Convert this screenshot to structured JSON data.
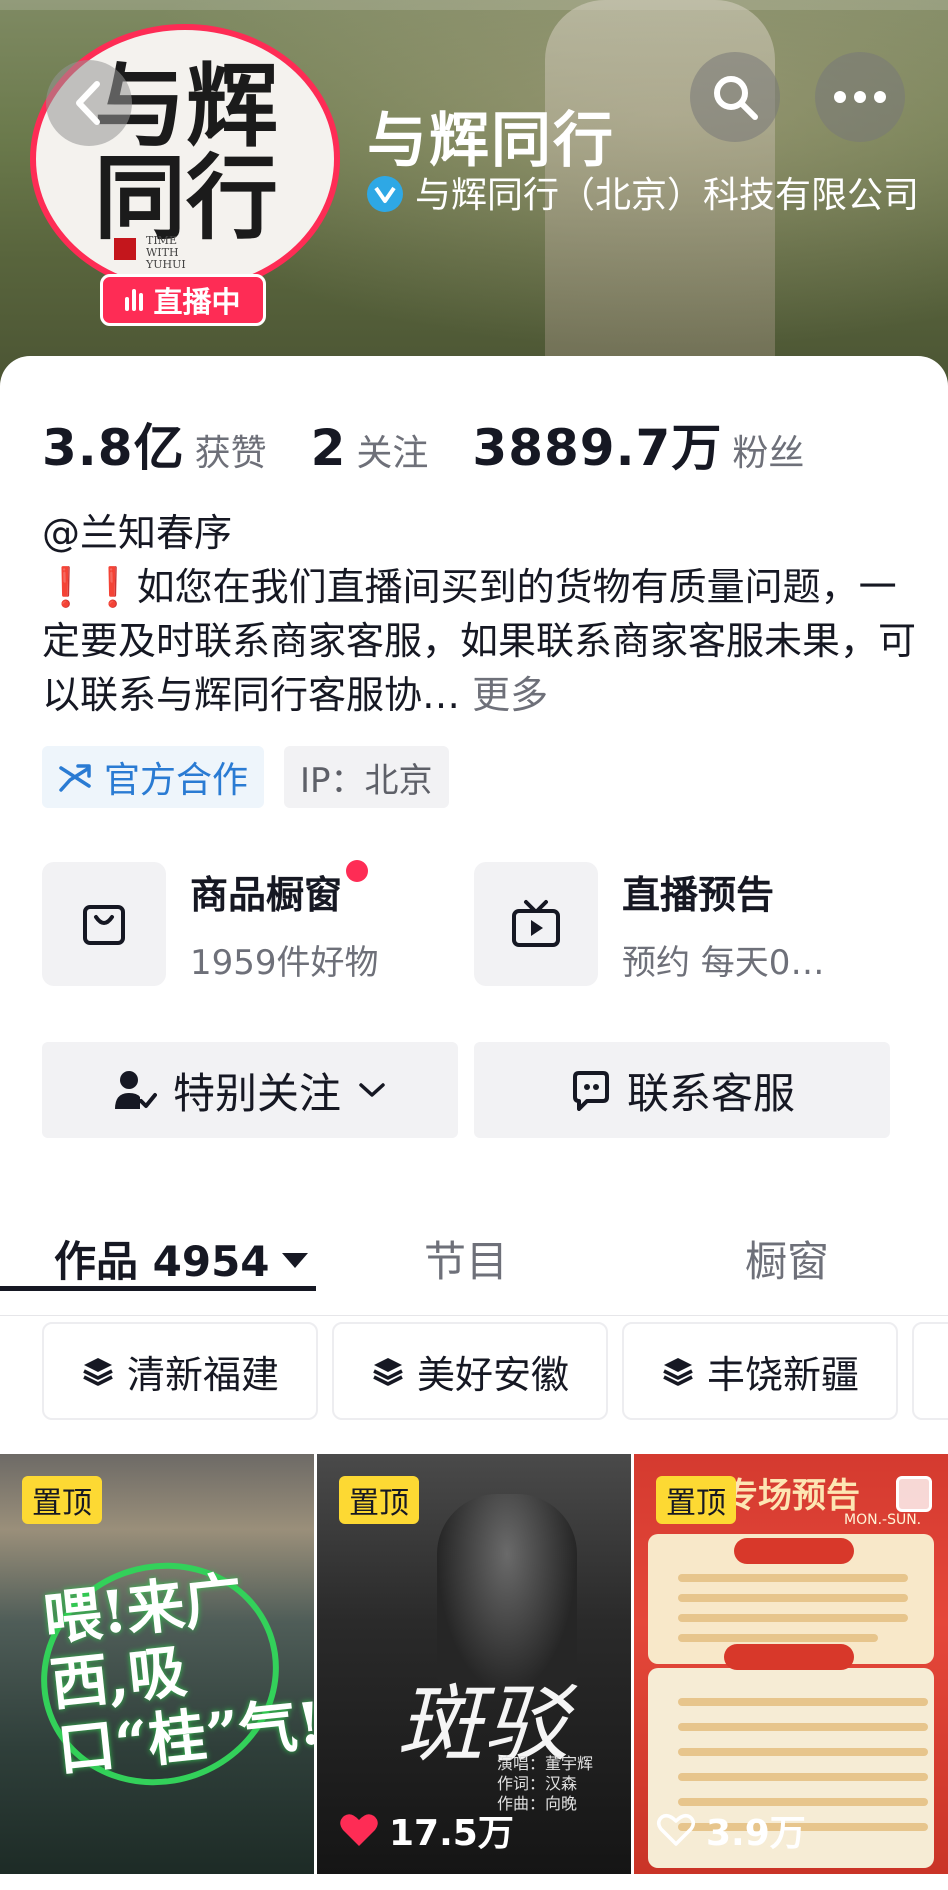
{
  "header": {
    "name": "与辉同行",
    "verification": "与辉同行（北京）科技有限公司",
    "live_badge": "直播中",
    "avatar_text_line1": "与辉",
    "avatar_text_line2": "同行",
    "avatar_english": "TIME WITH YUHUI"
  },
  "stats": [
    {
      "value": "3.8亿",
      "label": "获赞"
    },
    {
      "value": "2",
      "label": "关注"
    },
    {
      "value": "3889.7万",
      "label": "粉丝"
    }
  ],
  "bio": {
    "handle": "@兰知春序",
    "excl": "❗❗",
    "text": "如您在我们直播间买到的货物有质量问题，一定要及时联系商家客服，如果联系商家客服未果，可以联系与辉同行客服协…",
    "more": "更多"
  },
  "tags": {
    "official": "官方合作",
    "ip": "IP：北京"
  },
  "features": {
    "shop_title": "商品橱窗",
    "shop_sub": "1959件好物",
    "live_title": "直播预告",
    "live_sub": "预约 每天0…"
  },
  "actions": {
    "follow": "特别关注",
    "contact": "联系客服"
  },
  "tabs": {
    "works": "作品 4954",
    "programs": "节目",
    "showcase": "橱窗"
  },
  "collections": [
    "清新福建",
    "美好安徽",
    "丰饶新疆"
  ],
  "videos": [
    {
      "pin": "置顶",
      "likes": "",
      "cover_text": "喂!来广西,吸口“桂”气!"
    },
    {
      "pin": "置顶",
      "likes": "17.5万",
      "cover_title": "斑驳",
      "credits": [
        "演唱：董宇辉",
        "作词：汉森",
        "作曲：向晚"
      ]
    },
    {
      "pin": "置顶",
      "likes": "3.9万",
      "cover_head": "专场预告",
      "cover_sub": "MON.-SUN."
    }
  ],
  "colors": {
    "accent_red": "#fe2c55",
    "official_blue": "#2a7bd3",
    "pin_yellow": "#fdd933"
  }
}
